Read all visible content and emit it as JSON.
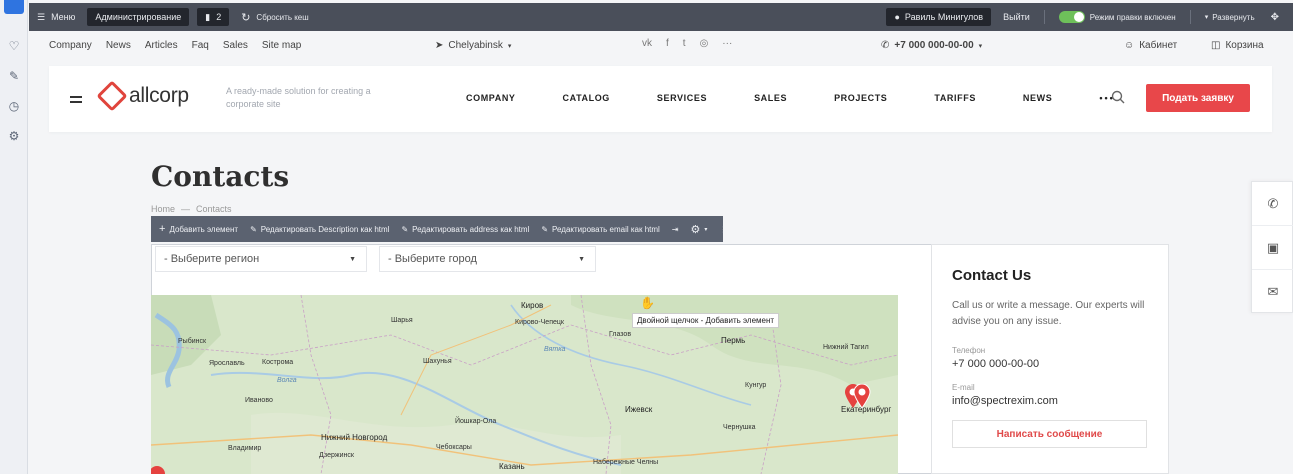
{
  "admin": {
    "menu_label": "Меню",
    "admin_label": "Администрирование",
    "badge_count": "2",
    "reset_cache": "Сбросить кеш",
    "user_name": "Равиль Минигулов",
    "logout": "Выйти",
    "edit_mode": "Режим правки включен",
    "expand": "Развернуть"
  },
  "topnav": {
    "links": [
      "Company",
      "News",
      "Articles",
      "Faq",
      "Sales",
      "Site map"
    ],
    "city": "Chelyabinsk",
    "phone": "+7 000 000-00-00",
    "cabinet": "Кабинет",
    "cart": "Корзина"
  },
  "header": {
    "logo": "allcorp",
    "tagline": "A ready-made solution for creating a corporate site",
    "menu": [
      "COMPANY",
      "CATALOG",
      "SERVICES",
      "SALES",
      "PROJECTS",
      "TARIFFS",
      "NEWS"
    ],
    "cta": "Подать заявку"
  },
  "page": {
    "title": "Contacts",
    "crumb_home": "Home",
    "crumb_sep": "—",
    "crumb_current": "Contacts"
  },
  "edit_bar": {
    "add": "Добавить элемент",
    "desc": "Редактировать Description как html",
    "address": "Редактировать address как html",
    "email": "Редактировать email как html"
  },
  "filters": {
    "region": "- Выберите регион",
    "city": "- Выберите город"
  },
  "map": {
    "tooltip": "Двойной щелчок - Добавить элемент",
    "labels": [
      "Киров",
      "Кирово-Чепецк",
      "Шарья",
      "Глазов",
      "Пермь",
      "Нижний Тагил",
      "Рыбинск",
      "Кострома",
      "Ярославль",
      "Шахунья",
      "Кунгур",
      "Иваново",
      "Ижевск",
      "Екатеринбург",
      "Йошкар-Ола",
      "Нижний Новгород",
      "Чебоксары",
      "Чернушка",
      "Владимир",
      "Дзержинск",
      "Казань",
      "Набережные Челны",
      "Волга",
      "Вятка"
    ]
  },
  "contact": {
    "title": "Contact Us",
    "desc": "Call us or write a message. Our experts will advise you on any issue.",
    "phone_label": "Телефон",
    "phone": "+7 000 000-00-00",
    "email_label": "E-mail",
    "email": "info@spectrexim.com",
    "button": "Написать сообщение"
  },
  "colors": {
    "accent": "#e8474a",
    "admin_bar": "#4a4f5a",
    "toggle": "#6ec05a"
  }
}
